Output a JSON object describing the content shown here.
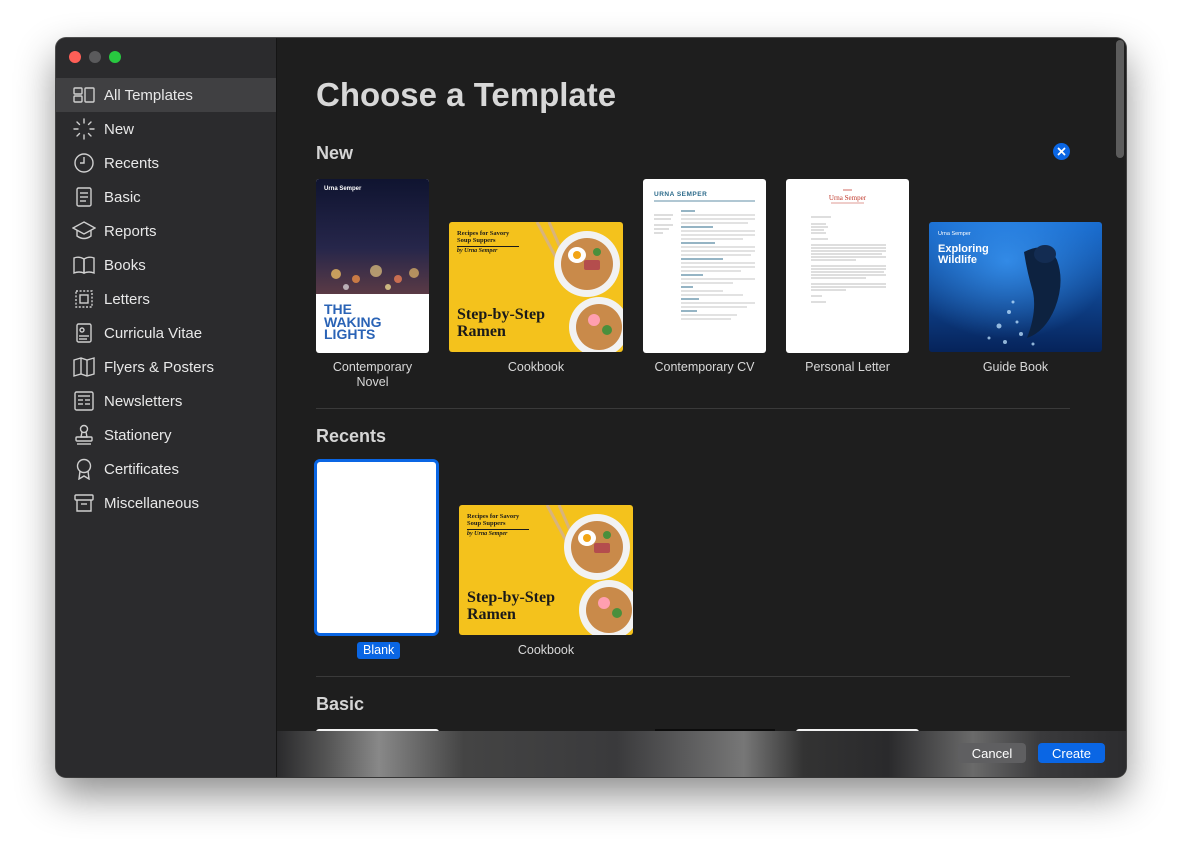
{
  "window": {
    "traffic_lights": [
      "#ff5f57",
      "#5a5a5c",
      "#28c840"
    ]
  },
  "sidebar": {
    "items": [
      {
        "label": "All Templates",
        "icon": "all-templates-icon",
        "selected": true
      },
      {
        "label": "New",
        "icon": "new-sparkle-icon"
      },
      {
        "label": "Recents",
        "icon": "clock-icon"
      },
      {
        "label": "Basic",
        "icon": "document-icon"
      },
      {
        "label": "Reports",
        "icon": "graduation-cap-icon"
      },
      {
        "label": "Books",
        "icon": "book-icon"
      },
      {
        "label": "Letters",
        "icon": "stamp-frame-icon"
      },
      {
        "label": "Curricula Vitae",
        "icon": "person-doc-icon"
      },
      {
        "label": "Flyers & Posters",
        "icon": "map-icon"
      },
      {
        "label": "Newsletters",
        "icon": "newsletter-icon"
      },
      {
        "label": "Stationery",
        "icon": "stamp-icon"
      },
      {
        "label": "Certificates",
        "icon": "ribbon-icon"
      },
      {
        "label": "Miscellaneous",
        "icon": "archive-box-icon"
      }
    ]
  },
  "main": {
    "title": "Choose a Template",
    "sections": {
      "new": "New",
      "recents": "Recents",
      "basic": "Basic"
    },
    "new_templates": [
      {
        "caption": "Contemporary\nNovel",
        "author": "Urna Semper",
        "cover_line1": "THE",
        "cover_line2": "WAKING",
        "cover_line3": "LIGHTS"
      },
      {
        "caption": "Cookbook",
        "subtitle": "Recipes for Savory Soup Suppers",
        "byline": "by Urna Semper",
        "headline": "Step-by-Step Ramen"
      },
      {
        "caption": "Contemporary CV",
        "name": "URNA SEMPER"
      },
      {
        "caption": "Personal Letter",
        "name": "Urna Semper"
      },
      {
        "caption": "Guide Book",
        "author": "Urna Semper",
        "headline": "Exploring Wildlife"
      }
    ],
    "recent_templates": [
      {
        "caption": "Blank",
        "selected": true
      },
      {
        "caption": "Cookbook",
        "subtitle": "Recipes for Savory Soup Suppers",
        "byline": "by Urna Semper",
        "headline": "Step-by-Step Ramen"
      }
    ]
  },
  "footer": {
    "cancel_label": "Cancel",
    "create_label": "Create"
  },
  "colors": {
    "accent": "#0a66e4",
    "cookbook_yellow": "#f4c21c"
  }
}
